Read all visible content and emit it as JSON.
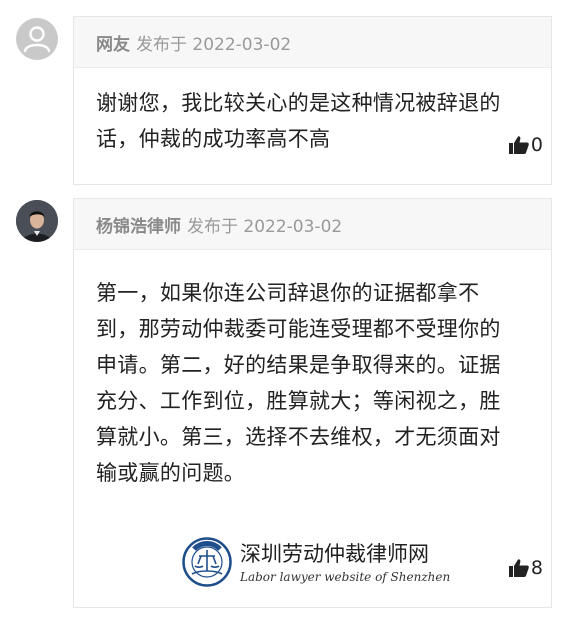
{
  "comments": [
    {
      "author": "网友",
      "meta": "发布于 2022-03-02",
      "lines": [
        "谢谢您，我比较关心的是这种情况被辞退的",
        "话，仲裁的成功率高不高"
      ],
      "likes": "0"
    },
    {
      "author": "杨锦浩律师",
      "meta": "发布于 2022-03-02",
      "lines": [
        "第一，如果你连公司辞退你的证据都拿不",
        "到，那劳动仲裁委可能连受理都不受理你的",
        "申请。第二，好的结果是争取得来的。证据",
        "充分、工作到位，胜算就大；等闲视之，胜",
        "算就小。第三，选择不去维权，才无须面对",
        "输或赢的问题。"
      ],
      "likes": "8"
    }
  ],
  "watermark": {
    "name_zh": "深圳劳动仲裁律师网",
    "name_en": "Labor lawyer website of Shenzhen",
    "seal_text": "深圳劳动仲裁律师"
  },
  "icons": {
    "like": "thumbs-up-icon",
    "guest_avatar": "user-icon"
  },
  "colors": {
    "header_bg": "#f7f7f7",
    "border": "#e6e6e6",
    "seal": "#1f4e8c"
  }
}
